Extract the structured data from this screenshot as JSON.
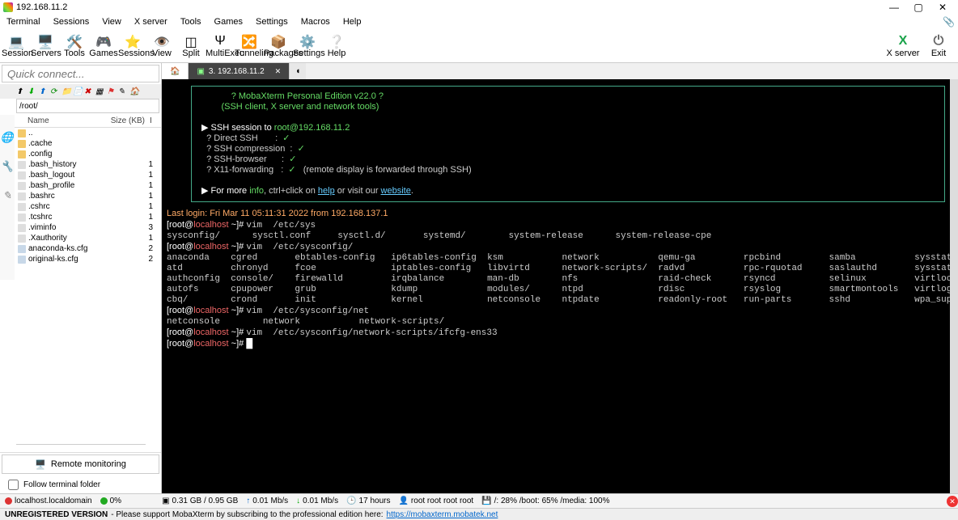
{
  "window": {
    "title": "192.168.11.2"
  },
  "menu": [
    "Terminal",
    "Sessions",
    "View",
    "X server",
    "Tools",
    "Games",
    "Settings",
    "Macros",
    "Help"
  ],
  "toolbar": [
    {
      "name": "session",
      "icon": "💻",
      "label": "Session"
    },
    {
      "name": "servers",
      "icon": "🖥️",
      "label": "Servers"
    },
    {
      "name": "tools",
      "icon": "🛠️",
      "label": "Tools"
    },
    {
      "name": "games",
      "icon": "🎮",
      "label": "Games"
    },
    {
      "name": "sessions",
      "icon": "⭐",
      "label": "Sessions"
    },
    {
      "name": "view",
      "icon": "👁️",
      "label": "View"
    },
    {
      "name": "split",
      "icon": "◫",
      "label": "Split"
    },
    {
      "name": "multiexec",
      "icon": "Ψ",
      "label": "MultiExec"
    },
    {
      "name": "tunneling",
      "icon": "🔀",
      "label": "Tunneling"
    },
    {
      "name": "packages",
      "icon": "📦",
      "label": "Packages"
    },
    {
      "name": "settings",
      "icon": "⚙️",
      "label": "Settings"
    },
    {
      "name": "help",
      "icon": "❔",
      "label": "Help"
    }
  ],
  "toolbar_right": [
    {
      "name": "xserver",
      "icon": "X",
      "label": "X server",
      "color": "#1aa34a"
    },
    {
      "name": "exit",
      "icon": "⏻",
      "label": "Exit",
      "color": "#666"
    }
  ],
  "quick_connect_placeholder": "Quick connect...",
  "sftp": {
    "path": "/root/",
    "cols": {
      "name": "Name",
      "size": "Size (KB)",
      "ext": "I"
    },
    "files": [
      {
        "name": "..",
        "type": "dir",
        "size": ""
      },
      {
        "name": ".cache",
        "type": "dir",
        "size": ""
      },
      {
        "name": ".config",
        "type": "dir",
        "size": ""
      },
      {
        "name": ".bash_history",
        "type": "file",
        "size": "1"
      },
      {
        "name": ".bash_logout",
        "type": "file",
        "size": "1"
      },
      {
        "name": ".bash_profile",
        "type": "file",
        "size": "1"
      },
      {
        "name": ".bashrc",
        "type": "file",
        "size": "1"
      },
      {
        "name": ".cshrc",
        "type": "file",
        "size": "1"
      },
      {
        "name": ".tcshrc",
        "type": "file",
        "size": "1"
      },
      {
        "name": ".viminfo",
        "type": "file",
        "size": "3"
      },
      {
        "name": ".Xauthority",
        "type": "file",
        "size": "1"
      },
      {
        "name": "anaconda-ks.cfg",
        "type": "cfg",
        "size": "2"
      },
      {
        "name": "original-ks.cfg",
        "type": "cfg",
        "size": "2"
      }
    ]
  },
  "remote_monitoring_label": "Remote monitoring",
  "follow_terminal_label": "Follow terminal folder",
  "tabs": {
    "active": "3. 192.168.11.2"
  },
  "motd": {
    "title": "? MobaXterm Personal Edition v22.0 ?",
    "subtitle": "(SSH client, X server and network tools)",
    "session_line": "▶ SSH session to ",
    "session_target": "root@192.168.11.2",
    "lines": [
      "? Direct SSH       :  ✓",
      "? SSH compression  :  ✓",
      "? SSH-browser      :  ✓",
      "? X11-forwarding   :  ✓   (remote display is forwarded through SSH)"
    ],
    "more_prefix": "▶ For more ",
    "more_info": "info",
    "more_mid": ", ctrl+click on ",
    "more_help": "help",
    "more_mid2": " or visit our ",
    "more_website": "website",
    "more_end": "."
  },
  "terminal": {
    "last_login": "Last login: Fri Mar 11 05:11:31 2022 from 192.168.137.1",
    "prompt_user": "root@",
    "prompt_host": "localhost",
    "prompt_tail": " ~]# ",
    "cmd1": "vim  /etc/sys",
    "line_sys": "sysconfig/      sysctl.conf     sysctl.d/       systemd/        system-release      system-release-cpe",
    "cmd2": "vim  /etc/sysconfig/",
    "grid": [
      [
        "anaconda",
        "cgred",
        "ebtables-config",
        "ip6tables-config",
        "ksm",
        "network",
        "qemu-ga",
        "rpcbind",
        "samba",
        "sysstat"
      ],
      [
        "atd",
        "chronyd",
        "fcoe",
        "iptables-config",
        "libvirtd",
        "network-scripts/",
        "radvd",
        "rpc-rquotad",
        "saslauthd",
        "sysstat.ioconf"
      ],
      [
        "authconfig",
        "console/",
        "firewalld",
        "irqbalance",
        "man-db",
        "nfs",
        "raid-check",
        "rsyncd",
        "selinux",
        "virtlockd"
      ],
      [
        "autofs",
        "cpupower",
        "grub",
        "kdump",
        "modules/",
        "ntpd",
        "rdisc",
        "rsyslog",
        "smartmontools",
        "virtlogd"
      ],
      [
        "cbq/",
        "crond",
        "init",
        "kernel",
        "netconsole",
        "ntpdate",
        "readonly-root",
        "run-parts",
        "sshd",
        "wpa_supplicant"
      ]
    ],
    "cmd3": "vim  /etc/sysconfig/net",
    "line_net": "netconsole        network           network-scripts/",
    "cmd4": "vim  /etc/sysconfig/network-scripts/ifcfg-ens33",
    "cursor": "█"
  },
  "status": {
    "host": "localhost.localdomain",
    "cpu": "0%",
    "ram": "0.31 GB / 0.95 GB",
    "up": "0.01 Mb/s",
    "down": "0.01 Mb/s",
    "uptime": "17 hours",
    "user": "root root root root",
    "disk": "/: 28%   /boot: 65%   /media: 100%"
  },
  "footer": {
    "prefix": "UNREGISTERED VERSION",
    "text": " - Please support MobaXterm by subscribing to the professional edition here: ",
    "link": "https://mobaxterm.mobatek.net"
  }
}
